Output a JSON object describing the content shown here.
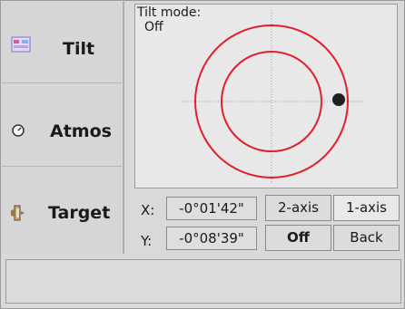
{
  "sidebar": {
    "items": [
      {
        "label": "Tilt",
        "icon": "tilt-icon"
      },
      {
        "label": "Atmos",
        "icon": "thermometer-dial-icon"
      },
      {
        "label": "Target",
        "icon": "prism-target-icon"
      }
    ]
  },
  "display": {
    "mode_title": "Tilt mode:",
    "mode_value": "Off",
    "circle_color": "#e0202c",
    "crosshair_color": "#9a9a9a",
    "bubble_color": "#202020"
  },
  "readouts": {
    "x_label": "X:",
    "x_value": "-0°01'42\"",
    "y_label": "Y:",
    "y_value": "-0°08'39\""
  },
  "buttons": {
    "two_axis": "2-axis",
    "one_axis": "1-axis",
    "off": "Off",
    "back": "Back"
  },
  "status_bar": {
    "text": ""
  }
}
